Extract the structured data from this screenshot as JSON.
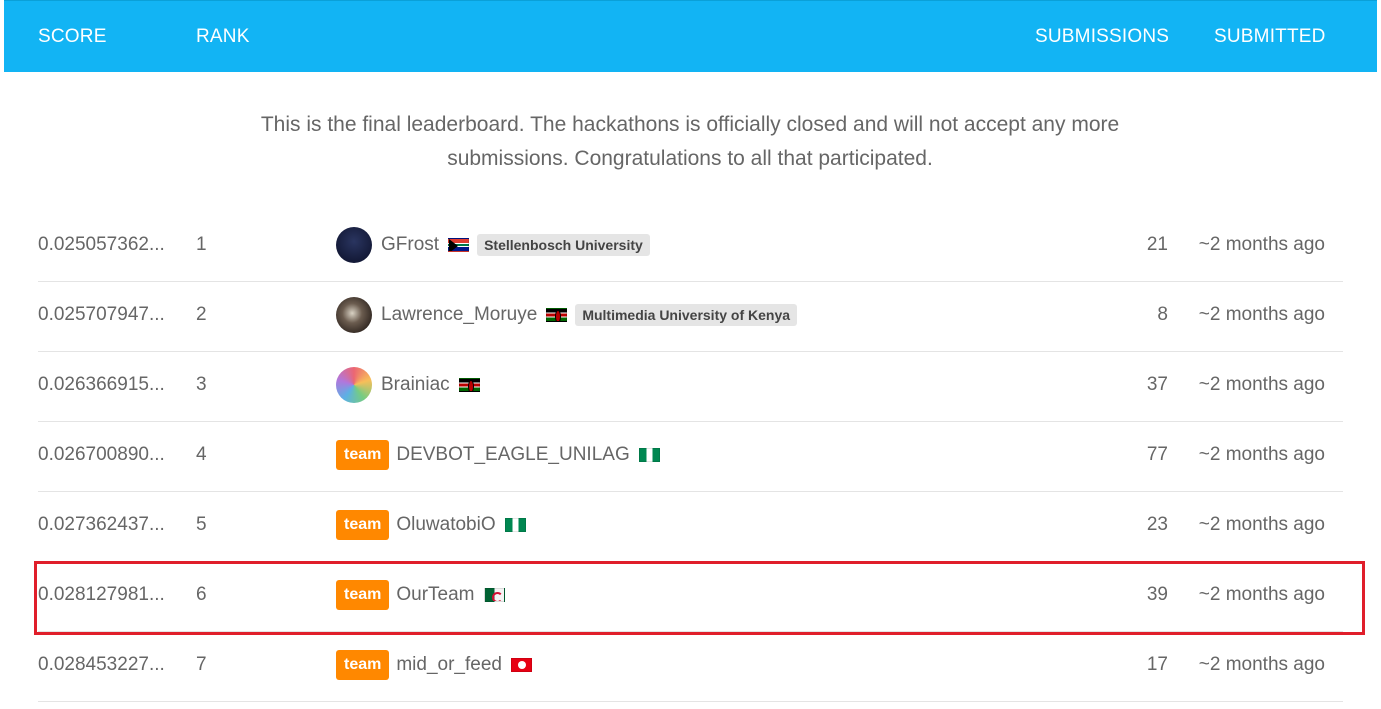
{
  "header": {
    "score": "SCORE",
    "rank": "RANK",
    "submissions": "SUBMISSIONS",
    "submitted": "SUBMITTED"
  },
  "notice": "This is the final leaderboard. The hackathons is officially closed and will not accept any more submissions. Congratulations to all that participated.",
  "team_label": "team",
  "rows": [
    {
      "score": "0.025057362...",
      "rank": "1",
      "name": "GFrost",
      "org": "Stellenbosch University",
      "submissions": "21",
      "submitted": "~2 months ago"
    },
    {
      "score": "0.025707947...",
      "rank": "2",
      "name": "Lawrence_Moruye",
      "org": "Multimedia University of Kenya",
      "submissions": "8",
      "submitted": "~2 months ago"
    },
    {
      "score": "0.026366915...",
      "rank": "3",
      "name": "Brainiac",
      "submissions": "37",
      "submitted": "~2 months ago"
    },
    {
      "score": "0.026700890...",
      "rank": "4",
      "name": "DEVBOT_EAGLE_UNILAG",
      "submissions": "77",
      "submitted": "~2 months ago"
    },
    {
      "score": "0.027362437...",
      "rank": "5",
      "name": "OluwatobiO",
      "submissions": "23",
      "submitted": "~2 months ago"
    },
    {
      "score": "0.028127981...",
      "rank": "6",
      "name": "OurTeam",
      "submissions": "39",
      "submitted": "~2 months ago"
    },
    {
      "score": "0.028453227...",
      "rank": "7",
      "name": "mid_or_feed",
      "submissions": "17",
      "submitted": "~2 months ago"
    }
  ],
  "colors": {
    "header": "#12b4f4",
    "team_badge": "#ff8800",
    "highlight": "#e01e2a"
  }
}
